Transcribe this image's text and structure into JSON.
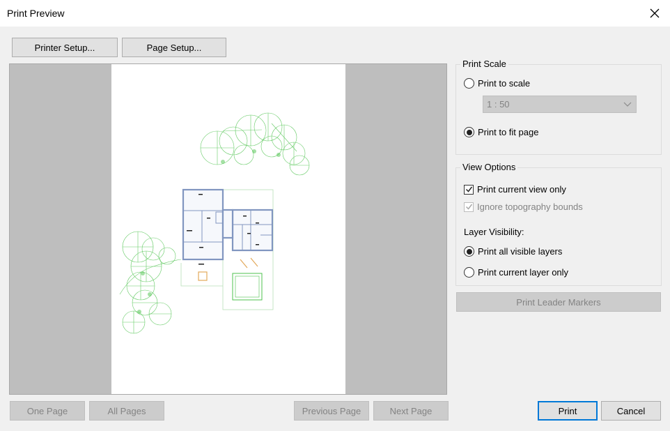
{
  "window": {
    "title": "Print Preview"
  },
  "toolbar": {
    "printer_setup": "Printer Setup...",
    "page_setup": "Page Setup..."
  },
  "print_scale": {
    "title": "Print Scale",
    "to_scale_label": "Print to scale",
    "scale_value": "1 : 50",
    "fit_page_label": "Print to fit page",
    "selected": "fit_page"
  },
  "view_options": {
    "title": "View Options",
    "current_view_only": "Print current view only",
    "ignore_topo": "Ignore topography bounds",
    "layer_visibility_label": "Layer Visibility:",
    "all_visible_layers": "Print all visible layers",
    "current_layer_only": "Print current layer only"
  },
  "leader_markers": "Print Leader Markers",
  "nav": {
    "one_page": "One Page",
    "all_pages": "All Pages",
    "previous_page": "Previous Page",
    "next_page": "Next Page"
  },
  "actions": {
    "print": "Print",
    "cancel": "Cancel"
  },
  "colors": {
    "accent": "#0078d7",
    "plant_green": "#4cc24c",
    "wall_blue": "#8196c0"
  }
}
